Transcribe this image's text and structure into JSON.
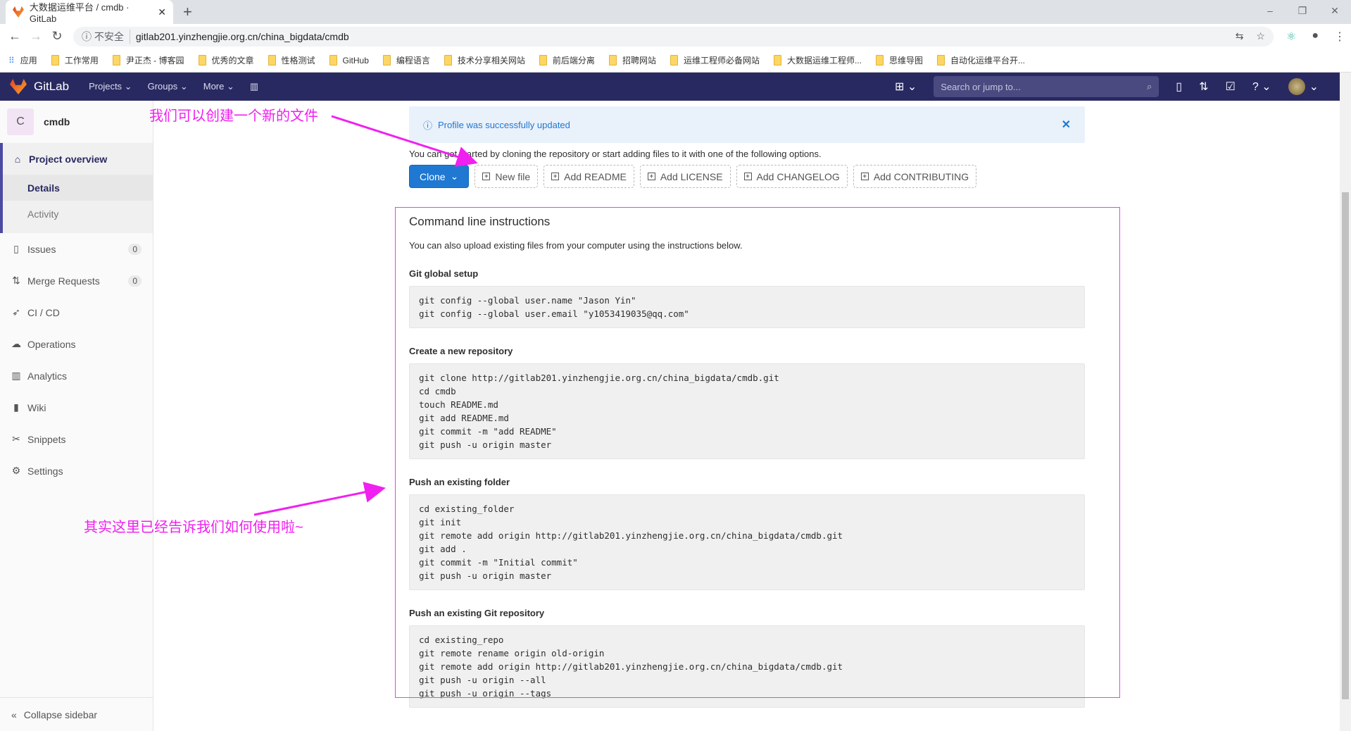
{
  "browser": {
    "tab_title": "大数据运维平台 / cmdb · GitLab",
    "new_tab": "+",
    "security": "不安全",
    "url": "gitlab201.yinzhengjie.org.cn/china_bigdata/cmdb",
    "bookmarks": [
      "应用",
      "工作常用",
      "尹正杰 - 博客园",
      "优秀的文章",
      "性格测试",
      "GitHub",
      "编程语言",
      "技术分享相关网站",
      "前后端分离",
      "招聘网站",
      "运维工程师必备网站",
      "大数据运维工程师...",
      "思维导图",
      "自动化运维平台开..."
    ]
  },
  "header": {
    "brand": "GitLab",
    "nav": [
      "Projects",
      "Groups",
      "More"
    ],
    "search_placeholder": "Search or jump to..."
  },
  "sidebar": {
    "project_letter": "C",
    "project_name": "cmdb",
    "overview": "Project overview",
    "sub": [
      "Details",
      "Activity"
    ],
    "items": [
      {
        "label": "Issues",
        "count": "0",
        "icon": "issues-icon"
      },
      {
        "label": "Merge Requests",
        "count": "0",
        "icon": "merge-request-icon"
      },
      {
        "label": "CI / CD",
        "icon": "rocket-icon"
      },
      {
        "label": "Operations",
        "icon": "cloud-icon"
      },
      {
        "label": "Analytics",
        "icon": "chart-icon"
      },
      {
        "label": "Wiki",
        "icon": "book-icon"
      },
      {
        "label": "Snippets",
        "icon": "scissors-icon"
      },
      {
        "label": "Settings",
        "icon": "gear-icon"
      }
    ],
    "collapse": "Collapse sidebar"
  },
  "main": {
    "flash": "Profile was successfully updated",
    "lead": "You can get started by cloning the repository or start adding files to it with one of the following options.",
    "clone": "Clone",
    "buttons": [
      "New file",
      "Add README",
      "Add LICENSE",
      "Add CHANGELOG",
      "Add CONTRIBUTING"
    ],
    "cli_title": "Command line instructions",
    "cli_desc": "You can also upload existing files from your computer using the instructions below.",
    "sections": [
      {
        "title": "Git global setup",
        "code": "git config --global user.name \"Jason Yin\"\ngit config --global user.email \"y1053419035@qq.com\""
      },
      {
        "title": "Create a new repository",
        "code": "git clone http://gitlab201.yinzhengjie.org.cn/china_bigdata/cmdb.git\ncd cmdb\ntouch README.md\ngit add README.md\ngit commit -m \"add README\"\ngit push -u origin master"
      },
      {
        "title": "Push an existing folder",
        "code": "cd existing_folder\ngit init\ngit remote add origin http://gitlab201.yinzhengjie.org.cn/china_bigdata/cmdb.git\ngit add .\ngit commit -m \"Initial commit\"\ngit push -u origin master"
      },
      {
        "title": "Push an existing Git repository",
        "code": "cd existing_repo\ngit remote rename origin old-origin\ngit remote add origin http://gitlab201.yinzhengjie.org.cn/china_bigdata/cmdb.git\ngit push -u origin --all\ngit push -u origin --tags"
      }
    ]
  },
  "annotations": {
    "new_file": "我们可以创建一个新的文件",
    "usage": "其实这里已经告诉我们如何使用啦~",
    "color": "#f020f0"
  }
}
